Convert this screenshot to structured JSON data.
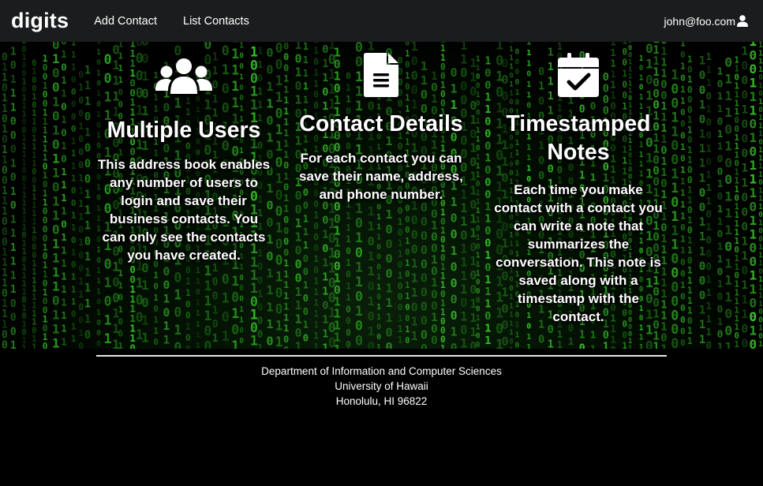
{
  "navbar": {
    "brand": "digits",
    "links": [
      {
        "label": "Add Contact"
      },
      {
        "label": "List Contacts"
      }
    ],
    "user": {
      "email": "john@foo.com",
      "icon": "user-icon"
    }
  },
  "features": [
    {
      "icon": "users-icon",
      "title": "Multiple Users",
      "text": "This address book enables any number of users to login and save their business contacts. You can only see the contacts you have created."
    },
    {
      "icon": "file-document-icon",
      "title": "Contact Details",
      "text": "For each contact you can save their name, address, and phone number."
    },
    {
      "icon": "calendar-check-icon",
      "title": "Timestamped Notes",
      "text": "Each time you make contact with a contact you can write a note that summarizes the conversation. This note is saved along with a timestamp with the contact."
    }
  ],
  "footer": {
    "line1": "Department of Information and Computer Sciences",
    "line2": "University of Hawaii",
    "line3": "Honolulu, HI 96822"
  },
  "colors": {
    "navbar_bg": "#1b1c1d",
    "matrix_green": "#39d12a",
    "page_bg": "#000000"
  }
}
